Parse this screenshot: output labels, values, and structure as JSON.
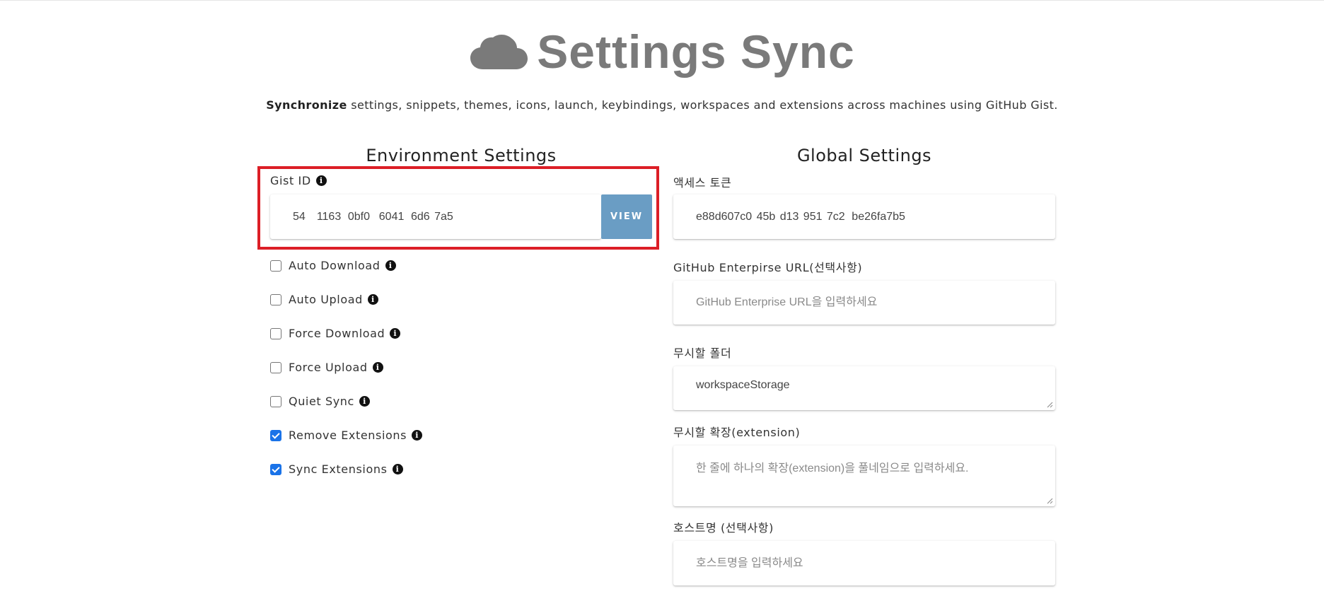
{
  "header": {
    "title": "Settings Sync",
    "cloud_icon": "cloud-icon",
    "subtitle_bold": "Synchronize",
    "subtitle_rest": " settings, snippets, themes, icons, launch, keybindings, workspaces and extensions across machines using GitHub Gist."
  },
  "environment": {
    "title": "Environment Settings",
    "gist_label": "Gist ID",
    "gist_value": "54     1163   0bf0    6041   6d6  7a5",
    "view_button": "VIEW",
    "checkboxes": [
      {
        "label": "Auto Download",
        "checked": false
      },
      {
        "label": "Auto Upload",
        "checked": false
      },
      {
        "label": "Force Download",
        "checked": false
      },
      {
        "label": "Force Upload",
        "checked": false
      },
      {
        "label": "Quiet Sync",
        "checked": false
      },
      {
        "label": "Remove Extensions",
        "checked": true
      },
      {
        "label": "Sync Extensions",
        "checked": true
      }
    ]
  },
  "global": {
    "title": "Global Settings",
    "access_token_label": "액세스 토큰",
    "access_token_value": "e88d607c0  45b  d13  951  7c2   be26fa7b5",
    "enterprise_label": "GitHub Enterpirse URL(선택사항)",
    "enterprise_placeholder": "GitHub Enterprise URL을 입력하세요",
    "ignore_folder_label": "무시할 폴더",
    "ignore_folder_value": "workspaceStorage",
    "ignore_ext_label": "무시할 확장(extension)",
    "ignore_ext_placeholder": "한 줄에 하나의 확장(extension)을 풀네임으로 입력하세요.",
    "hostname_label": "호스트명 (선택사항)",
    "hostname_placeholder": "호스트명을 입력하세요"
  },
  "colors": {
    "highlight": "#dc1e26",
    "view_button": "#6a9dc4",
    "checkbox_checked": "#1a73e8",
    "title_gray": "#7a7a7a"
  }
}
